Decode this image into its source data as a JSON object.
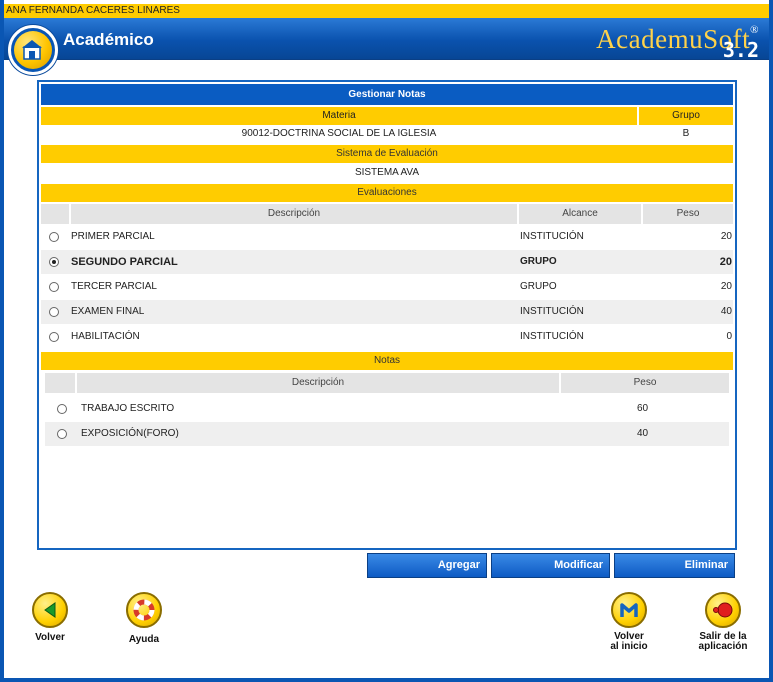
{
  "user_name": "ANA FERNANDA CACERES LINARES",
  "module": {
    "title": "Académico",
    "logo_icon": "house-book-icon"
  },
  "brand": {
    "name": "AcademuSoft",
    "version": "3.2",
    "registered": "®"
  },
  "panel": {
    "title": "Gestionar Notas",
    "materia_header": "Materia",
    "grupo_header": "Grupo",
    "materia_value": "90012-DOCTRINA SOCIAL DE LA IGLESIA",
    "grupo_value": "B",
    "sistema_header": "Sistema de Evaluación",
    "sistema_value": "SISTEMA AVA",
    "evaluaciones_header": "Evaluaciones",
    "eval_columns": {
      "descripcion": "Descripción",
      "alcance": "Alcance",
      "peso": "Peso"
    },
    "evaluaciones": [
      {
        "descripcion": "PRIMER PARCIAL",
        "alcance": "INSTITUCIÓN",
        "peso": "20",
        "selected": false
      },
      {
        "descripcion": "SEGUNDO PARCIAL",
        "alcance": "GRUPO",
        "peso": "20",
        "selected": true
      },
      {
        "descripcion": "TERCER PARCIAL",
        "alcance": "GRUPO",
        "peso": "20",
        "selected": false
      },
      {
        "descripcion": "EXAMEN FINAL",
        "alcance": "INSTITUCIÓN",
        "peso": "40",
        "selected": false
      },
      {
        "descripcion": "HABILITACIÓN",
        "alcance": "INSTITUCIÓN",
        "peso": "0",
        "selected": false
      }
    ],
    "notas_header": "Notas",
    "notas_columns": {
      "descripcion": "Descripción",
      "peso": "Peso"
    },
    "notas": [
      {
        "descripcion": "TRABAJO ESCRITO",
        "peso": "60",
        "selected": false
      },
      {
        "descripcion": "EXPOSICIÓN(FORO)",
        "peso": "40",
        "selected": false
      }
    ]
  },
  "actions": {
    "agregar": "Agregar",
    "modificar": "Modificar",
    "eliminar": "Eliminar"
  },
  "nav": {
    "volver": "Volver",
    "ayuda": "Ayuda",
    "volver_inicio_1": "Volver",
    "volver_inicio_2": "al inicio",
    "salir_1": "Salir de la",
    "salir_2": "aplicación"
  },
  "colors": {
    "primary": "#0a56b3",
    "accent": "#ffcc00",
    "row_alt": "#efefef"
  }
}
